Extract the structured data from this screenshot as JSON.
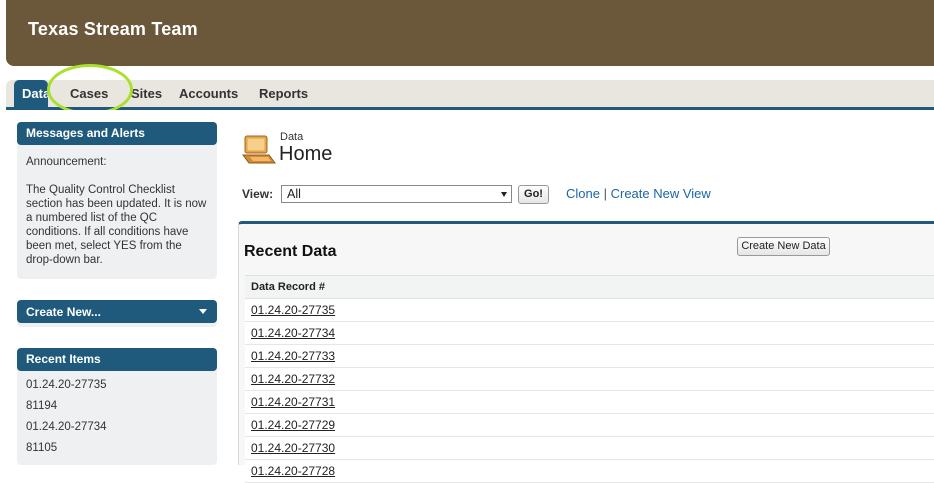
{
  "app": {
    "title": "Texas Stream Team"
  },
  "tabs": [
    {
      "label": "Data",
      "active": true
    },
    {
      "label": "Cases"
    },
    {
      "label": "Sites"
    },
    {
      "label": "Accounts"
    },
    {
      "label": "Reports"
    }
  ],
  "sidebar": {
    "messages": {
      "title": "Messages and Alerts",
      "heading": "Announcement:",
      "body": "The Quality Control Checklist section has been updated. It is now a numbered list of the QC conditions. If all conditions have been met, select YES from the drop-down bar."
    },
    "create_new": {
      "label": "Create New..."
    },
    "recent": {
      "title": "Recent Items",
      "items": [
        "01.24.20-27735",
        "81194",
        "01.24.20-27734",
        "81105"
      ]
    }
  },
  "main": {
    "breadcrumb": "Data",
    "title": "Home",
    "view": {
      "label": "View:",
      "selected": "All",
      "go_label": "Go!",
      "clone_label": "Clone",
      "create_view_label": "Create New View"
    },
    "recent_panel": {
      "title": "Recent Data",
      "create_button": "Create New Data",
      "column": "Data Record #",
      "rows": [
        "01.24.20-27735",
        "01.24.20-27734",
        "01.24.20-27733",
        "01.24.20-27732",
        "01.24.20-27731",
        "01.24.20-27729",
        "01.24.20-27730",
        "01.24.20-27728"
      ]
    }
  },
  "colors": {
    "header_brown": "#6b583a",
    "tab_blue": "#1f5a7d",
    "link_blue": "#1a66a8",
    "highlight_green": "#a8e02a"
  }
}
